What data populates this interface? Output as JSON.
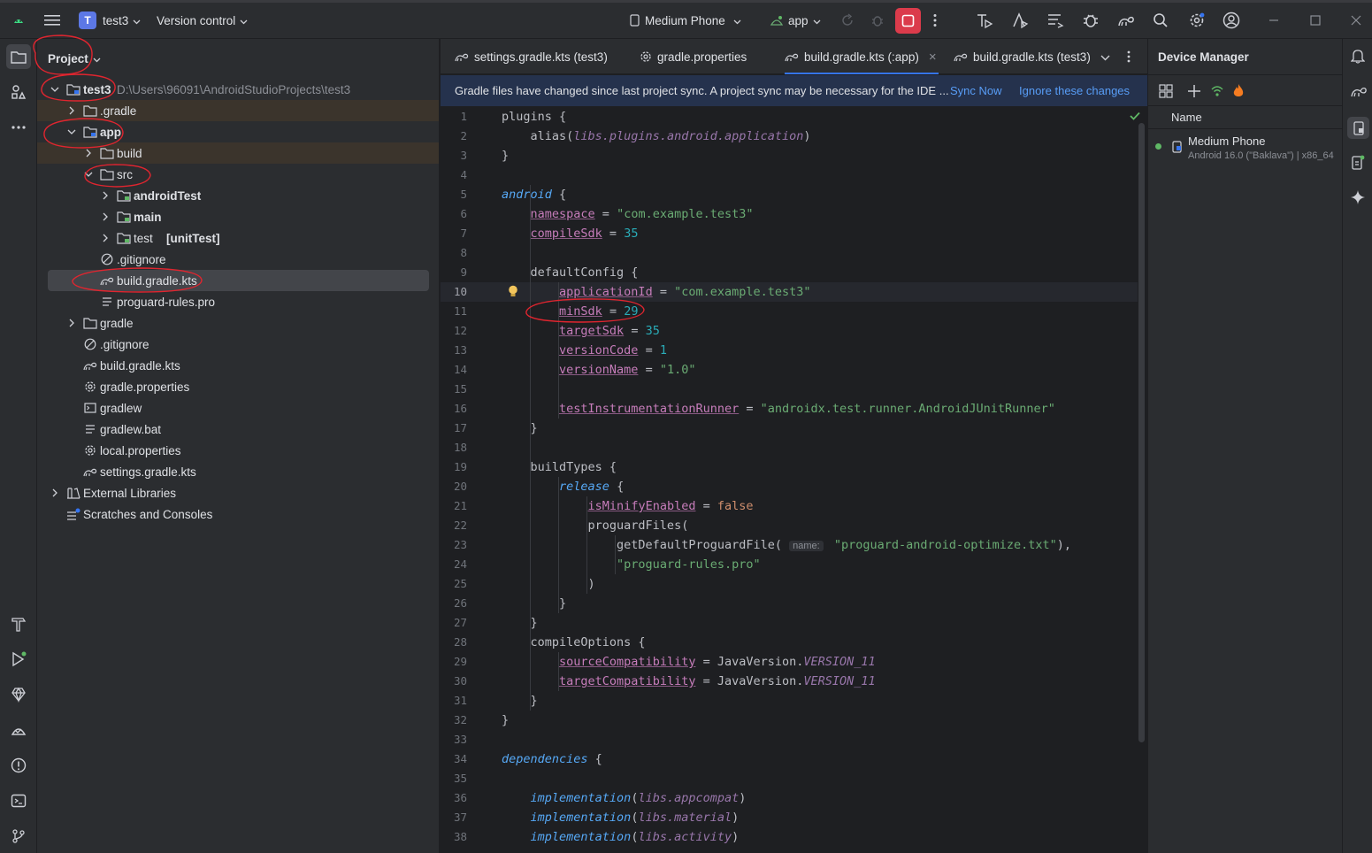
{
  "titlebar": {
    "project_badge": "T",
    "project_name": "test3",
    "vcs_label": "Version control",
    "device_label": "Medium Phone",
    "run_config": "app"
  },
  "project_panel": {
    "title": "Project",
    "tree": [
      {
        "label": "test3",
        "path": "D:\\Users\\96091\\AndroidStudioProjects\\test3"
      },
      {
        "label": ".gradle"
      },
      {
        "label": "app"
      },
      {
        "label": "build"
      },
      {
        "label": "src"
      },
      {
        "label": "androidTest"
      },
      {
        "label": "main"
      },
      {
        "label": "test",
        "suffix": "[unitTest]"
      },
      {
        "label": ".gitignore"
      },
      {
        "label": "build.gradle.kts"
      },
      {
        "label": "proguard-rules.pro"
      },
      {
        "label": "gradle"
      },
      {
        "label": ".gitignore"
      },
      {
        "label": "build.gradle.kts"
      },
      {
        "label": "gradle.properties"
      },
      {
        "label": "gradlew"
      },
      {
        "label": "gradlew.bat"
      },
      {
        "label": "local.properties"
      },
      {
        "label": "settings.gradle.kts"
      },
      {
        "label": "External Libraries"
      },
      {
        "label": "Scratches and Consoles"
      }
    ]
  },
  "editor": {
    "tabs": [
      {
        "label": "settings.gradle.kts (test3)"
      },
      {
        "label": "gradle.properties"
      },
      {
        "label": "build.gradle.kts (:app)",
        "close": "×"
      },
      {
        "label": "build.gradle.kts (test3)"
      }
    ],
    "banner": {
      "message": "Gradle files have changed since last project sync. A project sync may be necessary for the IDE ...",
      "sync_now": "Sync Now",
      "ignore": "Ignore these changes"
    },
    "current_line": 10,
    "code": [
      "plugins {",
      "    alias(libs.plugins.android.application)",
      "}",
      "",
      "android {",
      "    namespace = \"com.example.test3\"",
      "    compileSdk = 35",
      "",
      "    defaultConfig {",
      "        applicationId = \"com.example.test3\"",
      "        minSdk = 29",
      "        targetSdk = 35",
      "        versionCode = 1",
      "        versionName = \"1.0\"",
      "",
      "        testInstrumentationRunner = \"androidx.test.runner.AndroidJUnitRunner\"",
      "    }",
      "",
      "    buildTypes {",
      "        release {",
      "            isMinifyEnabled = false",
      "            proguardFiles(",
      "                getDefaultProguardFile( name: \"proguard-android-optimize.txt\"),",
      "                \"proguard-rules.pro\"",
      "            )",
      "        }",
      "    }",
      "    compileOptions {",
      "        sourceCompatibility = JavaVersion.VERSION_11",
      "        targetCompatibility = JavaVersion.VERSION_11",
      "    }",
      "}",
      "",
      "dependencies {",
      "",
      "    implementation(libs.appcompat)",
      "    implementation(libs.material)",
      "    implementation(libs.activity)"
    ]
  },
  "device_manager": {
    "title": "Device Manager",
    "column_name": "Name",
    "devices": [
      {
        "name": "Medium Phone",
        "detail": "Android 16.0 (\"Baklava\") | x86_64",
        "status_color": "#5fb865"
      }
    ]
  },
  "colors": {
    "accent": "#3574f0",
    "stop_button": "#db3b4b",
    "annotation_red": "#e0252f",
    "link": "#589df6"
  }
}
